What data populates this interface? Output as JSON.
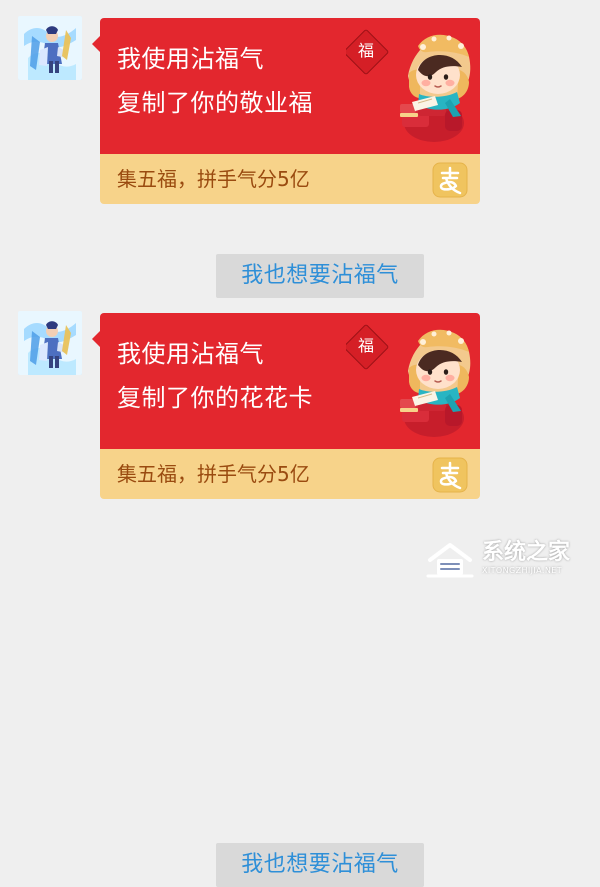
{
  "messages": [
    {
      "title_line1": "我使用沾福气",
      "title_line2": "复制了你的敬业福",
      "footer_text": "集五福，拼手气分5亿",
      "fu_mark": "福",
      "action_label": "我也想要沾福气"
    },
    {
      "title_line1": "我使用沾福气",
      "title_line2": "复制了你的花花卡",
      "footer_text": "集五福，拼手气分5亿",
      "fu_mark": "福",
      "action_label": "我也想要沾福气"
    }
  ],
  "watermark": {
    "text": "系统之家",
    "url": "XITONGZHIJIA.NET"
  },
  "colors": {
    "background": "#efefef",
    "card_red": "#e3272e",
    "card_footer": "#f7d38a",
    "action_button": "#d9d9d9",
    "action_text": "#2e8fd8"
  },
  "icons": {
    "avatar": "avatar-image",
    "illustration": "fortune-child-illustration",
    "alipay": "alipay-icon",
    "watermark": "house-logo-icon"
  }
}
